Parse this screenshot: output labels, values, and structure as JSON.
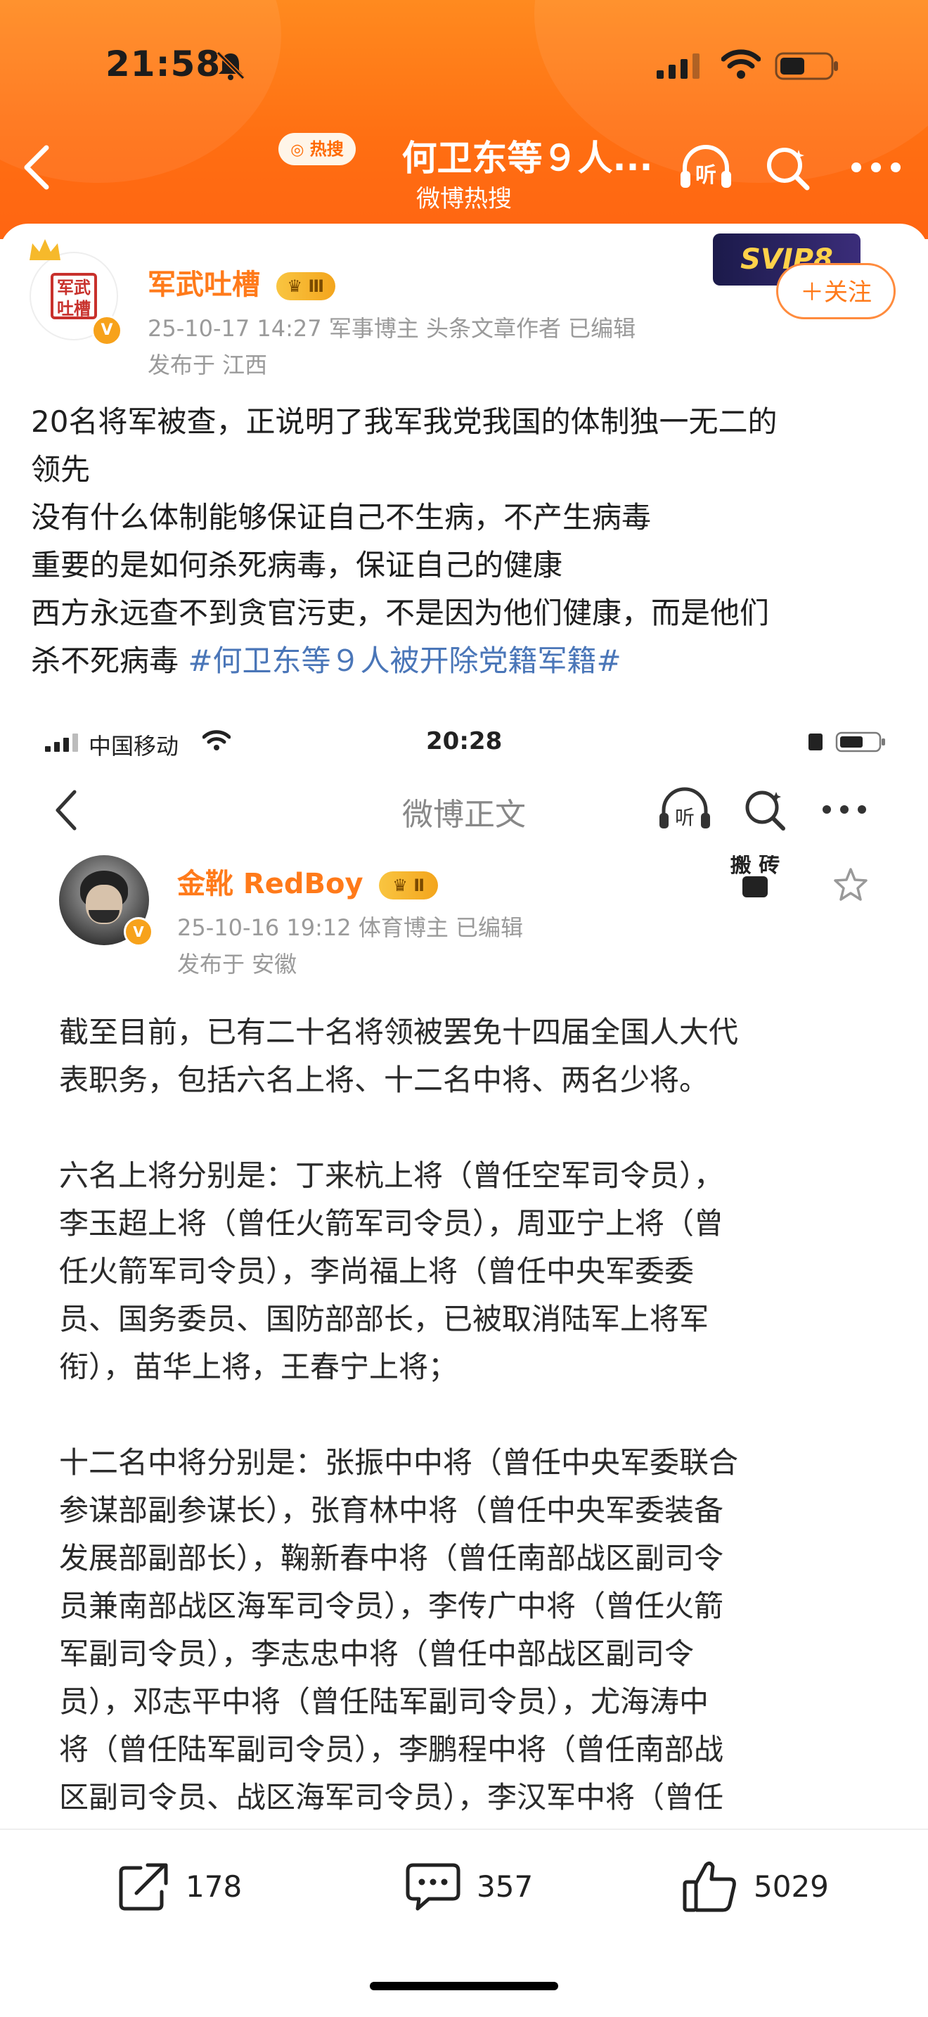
{
  "status_bar": {
    "time": "21:58"
  },
  "header": {
    "hot_badge": "热搜",
    "title": "何卫东等９人...",
    "subtitle": "微博热搜"
  },
  "post": {
    "author": "军武吐槽",
    "level": "Ⅲ",
    "vip_label": "SVIP8",
    "avatar_text": "军武吐槽",
    "meta_line1": "25-10-17 14:27  军事博主 头条文章作者  已编辑",
    "meta_line2": "发布于 江西",
    "follow_label": "＋关注",
    "text_lines": [
      "20名将军被查，正说明了我军我党我国的体制独一无二的",
      "领先",
      "没有什么体制能够保证自己不生病，不产生病毒",
      "重要的是如何杀死病毒，保证自己的健康",
      "西方永远查不到贪官污吏，不是因为他们健康，而是他们"
    ],
    "last_line_text": "杀不死病毒 ",
    "topic": "#何卫东等９人被开除党籍军籍#"
  },
  "embedded": {
    "status": {
      "carrier": "中国移动",
      "time": "20:28"
    },
    "nav_title": "微博正文",
    "author": "金靴 RedBoy",
    "level": "Ⅱ",
    "meta_line1": "25-10-16 19:12  体育博主  已编辑",
    "meta_line2": "发布于 安徽",
    "sticker_text": "搬 砖",
    "paragraph_lines": [
      "截至目前，已有二十名将领被罢免十四届全国人大代",
      "表职务，包括六名上将、十二名中将、两名少将。",
      "",
      "六名上将分别是：丁来杭上将（曾任空军司令员），",
      "李玉超上将（曾任火箭军司令员），周亚宁上将（曾",
      "任火箭军司令员），李尚福上将（曾任中央军委委",
      "员、国务委员、国防部部长，已被取消陆军上将军",
      "衔），苗华上将，王春宁上将；",
      "",
      "十二名中将分别是：张振中中将（曾任中央军委联合",
      "参谋部副参谋长），张育林中将（曾任中央军委装备",
      "发展部副部长），鞠新春中将（曾任南部战区副司令",
      "员兼南部战区海军司令员），李传广中将（曾任火箭",
      "军副司令员），李志忠中将（曾任中部战区副司令",
      "员），邓志平中将（曾任陆军副司令员），尤海涛中",
      "将（曾任陆军副司令员），李鹏程中将（曾任南部战",
      "区副司令员、战区海军司令员），李汉军中将（曾任"
    ]
  },
  "actions": {
    "repost_count": "178",
    "comment_count": "357",
    "like_count": "5029"
  },
  "colors": {
    "header_orange": "#ff7216",
    "name_orange": "#ff7a1a",
    "topic_blue": "#4a76b8",
    "meta_gray": "#9a9a9a"
  },
  "icons": [
    "back-icon",
    "listen-icon",
    "search-icon",
    "more-icon",
    "star-icon",
    "repost-icon",
    "comment-icon",
    "like-icon",
    "wifi-icon",
    "battery-icon",
    "mute-icon",
    "signal-icon"
  ]
}
